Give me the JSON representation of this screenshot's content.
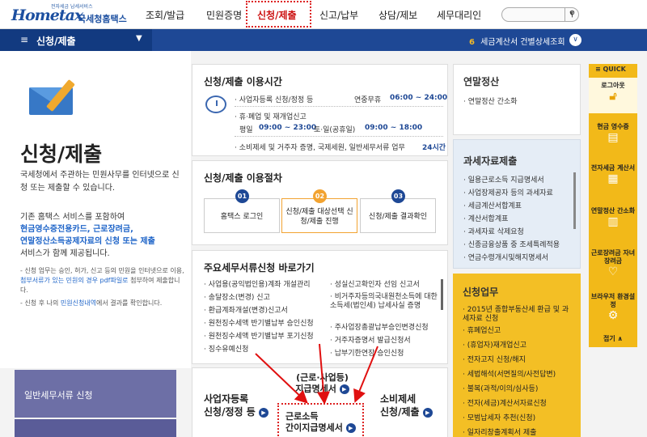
{
  "header": {
    "logo_small": "전자세금 납세서비스",
    "logo_main": "Hometax",
    "logo_korean": "국세청홈택스",
    "nav": [
      "조회/발급",
      "민원증명",
      "신청/제출",
      "신고/납부",
      "상담/제보",
      "세무대리인"
    ],
    "search_placeholder": ""
  },
  "bluebar": {
    "menu_title": "신청/제출",
    "notice_num": "6",
    "notice_text": "세금계산서 건별상세조회"
  },
  "hero": {
    "title": "신청/제출",
    "desc1": "국세청에서 주관하는 민원사무를 인터넷으로 신청 또는 제출할 수 있습니다.",
    "desc2a": "기존 홈택스 서비스를 포함하여",
    "desc2b": "현금영수증전용카드, 근로장려금,",
    "desc2c": "연말정산소득공제자료의 신청 또는 제출",
    "desc2d": "서비스가 함께 제공됩니다.",
    "note1a": "- 신청 업무는 승인, 허가, 신고 등의 민원을 인터넷으로 이용, ",
    "note1b": "첨부서류가 있는 민원의 경우 pdf파일로",
    "note1c": " 첨부하여 제출합니다.",
    "note2a": "- 신청 후 나의 ",
    "note2b": "민원신청내역",
    "note2c": "에서 결과를 확인합니다."
  },
  "left_buttons": {
    "general": "일반세무서류 신청"
  },
  "hours": {
    "title": "신청/제출 이용시간",
    "row1_label": "· 사업자등록 신청/정정 등",
    "row1_value_label": "연중무휴",
    "row1_value": "06:00 ~ 24:00",
    "row2_label": "· 휴·폐업 및 재개업신고",
    "row3_a": "평일",
    "row3_b": "09:00 ~ 23:00",
    "row3_c": "토·일(공휴일)",
    "row3_d": "09:00 ~ 18:00",
    "row4_label": "· 소비제세 및 거주자 증명, 국제세원, 일반세무서류 업무",
    "row4_value": "24시간"
  },
  "procedure": {
    "title": "신청/제출 이용절차",
    "steps": [
      {
        "num": "01",
        "label": "홈택스 로그인"
      },
      {
        "num": "02",
        "label": "신청/제출 대상선택 신청/제출 진행"
      },
      {
        "num": "03",
        "label": "신청/제출 결과확인"
      }
    ]
  },
  "shortcuts": {
    "title": "주요세무서류신청 바로가기",
    "left": [
      "· 사업용(공익법인용)계좌 개설관리",
      "· 송달장소(변경) 신고",
      "· 환급계좌개설(변경)신고서",
      "· 원천징수세액 반기별납부 승인신청",
      "· 원천징수세액 반기별납부 포기신청",
      "· 징수유예신청"
    ],
    "right": [
      "· 성실신고확인자 선임 신고서",
      "· 비거주자등의국내원천소득에 대한 소득세(법인세) 납세사실 증명",
      "· 주사업장총괄납부승인변경신청",
      "· 거주자증명서 발급신청서",
      "· 납부기한연장 승인신청"
    ]
  },
  "bottom_cards": {
    "biz_a": "사업자등록",
    "biz_b": "신청/정정 등",
    "mid1_a": "(근로·사업등)",
    "mid1_b": "지급명세서",
    "mid2_a": "근로소득",
    "mid2_b": "간이지급명세서",
    "cons_a": "소비제세",
    "cons_b": "신청/제출"
  },
  "yearend": {
    "title": "연말정산",
    "item": "· 연말정산 간소화"
  },
  "taxdata": {
    "title": "과세자료제출",
    "items": [
      "· 일용근로소득 지급명세서",
      "· 사업장제공자 등의 과세자료",
      "· 세금계산서합계표",
      "· 계산서합계표",
      "· 과세자료 삭제요청",
      "· 신종금융상품 중 조세특례적용",
      "· 연금수령개시및해지명세서"
    ]
  },
  "apply": {
    "title": "신청업무",
    "items": [
      "· 2015년 종합부동산세 환급 및 과세자료 신청",
      "· 휴폐업신고",
      "· (휴업자)재개업신고",
      "· 전자고지 신청/해지",
      "· 세법해석(서면질의/사전답변)",
      "· 불복(과적/이의/심사등)",
      "· 전자(세금)계산서자료신청",
      "· 모범납세자 추천(신청)",
      "· 일자리창출계획서 제출"
    ]
  },
  "quick": {
    "head": "≡ QUICK",
    "items": [
      {
        "label": "로그아웃",
        "icon": "lock-icon"
      },
      {
        "label": "현금 영수증",
        "icon": "receipt-icon"
      },
      {
        "label": "전자세금 계산서",
        "icon": "invoice-icon"
      },
      {
        "label": "연말정산 간소화",
        "icon": "doc-icon"
      },
      {
        "label": "근로장려금 자녀장려금",
        "icon": "heart-icon"
      },
      {
        "label": "브라우저 환경설정",
        "icon": "gear-icon"
      },
      {
        "label": "접기 ∧",
        "icon": ""
      }
    ]
  }
}
